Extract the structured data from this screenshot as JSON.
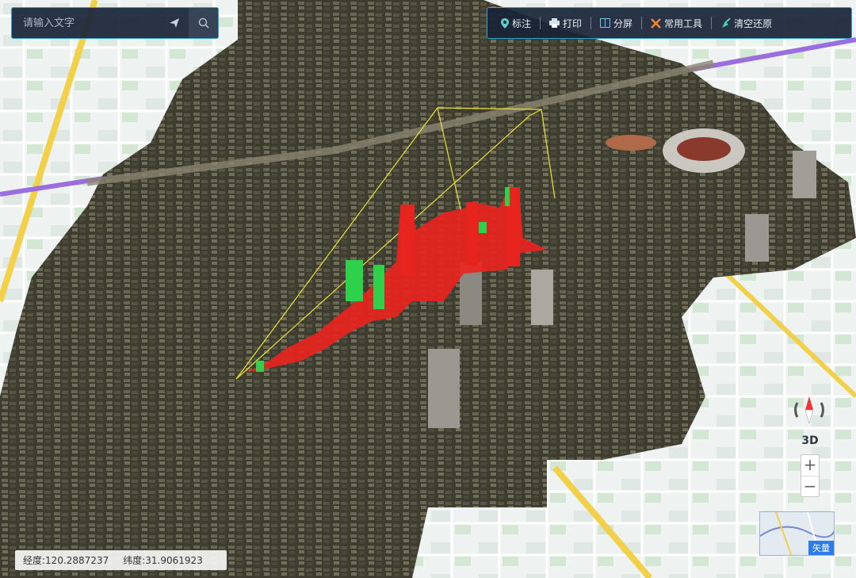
{
  "search": {
    "placeholder": "请输入文字"
  },
  "toolbar": {
    "items": [
      {
        "label": "标注",
        "icon": "marker-icon"
      },
      {
        "label": "打印",
        "icon": "printer-icon"
      },
      {
        "label": "分屏",
        "icon": "split-screen-icon"
      },
      {
        "label": "常用工具",
        "icon": "tools-icon"
      },
      {
        "label": "清空还原",
        "icon": "clear-icon"
      }
    ]
  },
  "map_controls": {
    "view_mode": "3D",
    "zoom_in": "+",
    "zoom_out": "−",
    "basemap_label": "矢量"
  },
  "coordinates": {
    "lng_label": "经度:",
    "lng_value": "120.2887237",
    "lat_label": "纬度:",
    "lat_value": "31.9061923"
  },
  "colors": {
    "panel": "#192337",
    "border": "#2fa3c8",
    "accent_red": "#e8241f",
    "accent_green": "#2fd14a",
    "road_purple": "#9b6ee0",
    "road_yellow": "#f2d04a"
  }
}
